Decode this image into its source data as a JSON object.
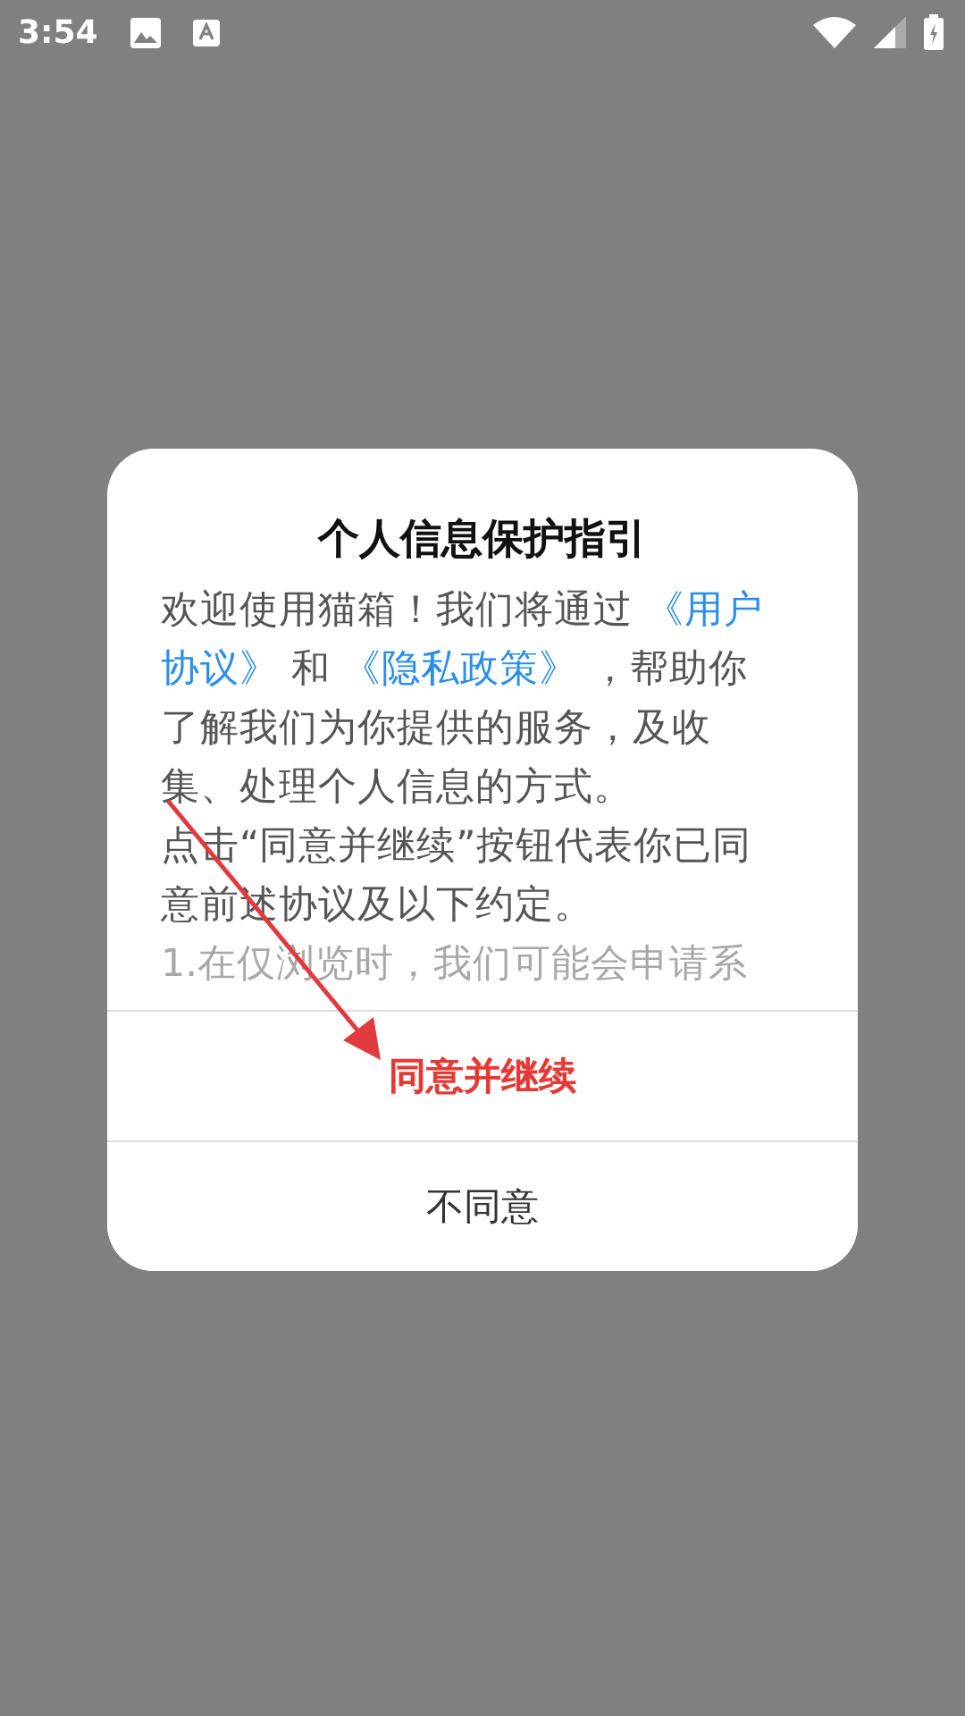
{
  "status_bar": {
    "time": "3:54"
  },
  "dialog": {
    "title": "个人信息保护指引",
    "paragraphs": [
      {
        "kind": "normal",
        "segments": [
          {
            "kind": "text",
            "text": "欢迎使用猫箱！我们将通过 "
          },
          {
            "kind": "link",
            "text": "《用户"
          },
          {
            "kind": "link",
            "text": "协议》"
          },
          {
            "kind": "text",
            "text": " 和 "
          },
          {
            "kind": "link",
            "text": "《隐私政策》"
          },
          {
            "kind": "text",
            "text": " ，帮助你了解我们为你提供的服务，及收集、处理个人信息的方式。"
          }
        ]
      },
      {
        "kind": "normal",
        "segments": [
          {
            "kind": "text",
            "text": "点击“同意并继续”按钮代表你已同意前述协议及以下约定。"
          }
        ]
      },
      {
        "kind": "faded",
        "segments": [
          {
            "kind": "text",
            "text": "1.在仅浏览时，我们可能会申请系"
          }
        ]
      }
    ],
    "buttons": [
      {
        "kind": "primary",
        "label": "同意并继续"
      },
      {
        "kind": "secondary",
        "label": "不同意"
      }
    ]
  }
}
